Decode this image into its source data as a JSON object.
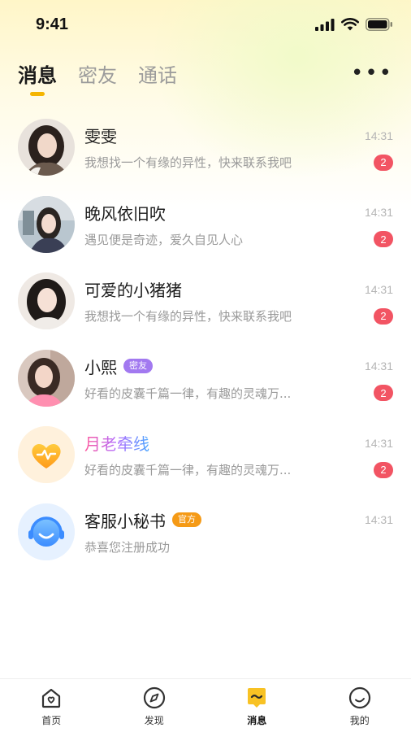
{
  "status_bar": {
    "time": "9:41"
  },
  "tabs": [
    {
      "label": "消息",
      "active": true
    },
    {
      "label": "密友",
      "active": false
    },
    {
      "label": "通话",
      "active": false
    }
  ],
  "more_label": "•••",
  "conversations": [
    {
      "name": "雯雯",
      "time": "14:31",
      "preview": "我想找一个有缘的异性，快来联系我吧",
      "unread": "2",
      "tag": ""
    },
    {
      "name": "晚风依旧吹",
      "time": "14:31",
      "preview": "遇见便是奇迹，爱久自见人心",
      "unread": "2",
      "tag": ""
    },
    {
      "name": "可爱的小猪猪",
      "time": "14:31",
      "preview": "我想找一个有缘的异性，快来联系我吧",
      "unread": "2",
      "tag": ""
    },
    {
      "name": "小熙",
      "time": "14:31",
      "preview": "好看的皮囊千篇一律，有趣的灵魂万...",
      "unread": "2",
      "tag": "密友"
    },
    {
      "name": "月老牵线",
      "time": "14:31",
      "preview": "好看的皮囊千篇一律，有趣的灵魂万...",
      "unread": "2",
      "tag": ""
    },
    {
      "name": "客服小秘书",
      "time": "14:31",
      "preview": "恭喜您注册成功",
      "unread": "",
      "tag": "官方"
    }
  ],
  "bottom_nav": [
    {
      "label": "首页",
      "icon": "home-icon"
    },
    {
      "label": "发现",
      "icon": "compass-icon"
    },
    {
      "label": "消息",
      "icon": "message-icon",
      "active": true
    },
    {
      "label": "我的",
      "icon": "profile-icon"
    }
  ],
  "colors": {
    "accent": "#f5b500",
    "unread_badge": "#f25463",
    "tag_purple": "#a279f0",
    "tag_orange": "#f59a16"
  }
}
